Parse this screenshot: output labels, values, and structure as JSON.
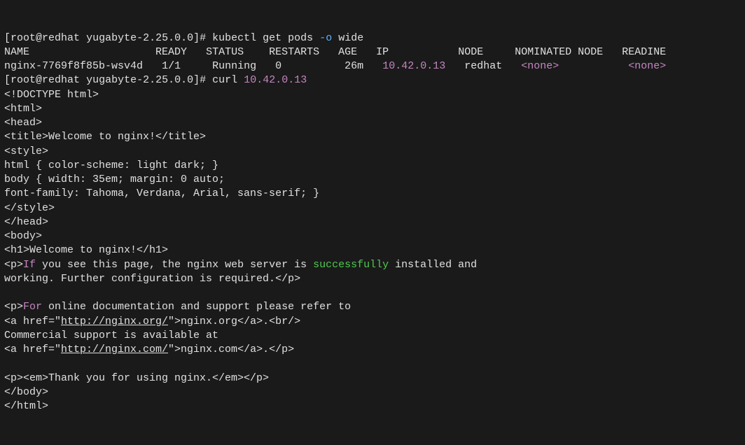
{
  "prompt1": {
    "user": "root",
    "at": "@",
    "host": "redhat",
    "cwd": "yugabyte-2.25.0.0",
    "hash": "#",
    "cmd": "kubectl get pods",
    "opt": "-o",
    "arg": "wide"
  },
  "columns": {
    "name": "NAME",
    "ready": "READY",
    "status": "STATUS",
    "restarts": "RESTARTS",
    "age": "AGE",
    "ip": "IP",
    "node": "NODE",
    "nominated": "NOMINATED NODE",
    "readiness": "READINE"
  },
  "row": {
    "name": "nginx-7769f8f85b-wsv4d",
    "ready": "1/1",
    "status": "Running",
    "restarts": "0",
    "age": "26m",
    "ip": "10.42.0.13",
    "node": "redhat",
    "nominated": "<none>",
    "readiness": "<none>"
  },
  "prompt2": {
    "user": "root",
    "at": "@",
    "host": "redhat",
    "cwd": "yugabyte-2.25.0.0",
    "hash": "#",
    "cmd": "curl",
    "ip": "10.42.0.13"
  },
  "html_out": {
    "l1": "<!DOCTYPE html>",
    "l2": "<html>",
    "l3": "<head>",
    "l4": "<title>Welcome to nginx!</title>",
    "l5": "<style>",
    "l6": "html { color-scheme: light dark; }",
    "l7": "body { width: 35em; margin: 0 auto;",
    "l8": "font-family: Tahoma, Verdana, Arial, sans-serif; }",
    "l9": "</style>",
    "l10": "</head>",
    "l11": "<body>",
    "l12": "<h1>Welcome to nginx!</h1>",
    "p1a": "<p>",
    "p1b": "If",
    "p1c": " you see this page, the nginx web server is ",
    "p1d": "successfully",
    "p1e": " installed and",
    "l14": "working. Further configuration is required.</p>",
    "p2a": "<p>",
    "p2b": "For",
    "p2c": " online documentation and support please refer to",
    "l16a": "<a href=\"",
    "l16b": "http://nginx.org/",
    "l16c": "\">nginx.org</a>.<br/>",
    "l17": "Commercial support is available at",
    "l18a": "<a href=\"",
    "l18b": "http://nginx.com/",
    "l18c": "\">nginx.com</a>.</p>",
    "l19": "<p><em>Thank you for using nginx.</em></p>",
    "l20": "</body>",
    "l21": "</html>"
  }
}
